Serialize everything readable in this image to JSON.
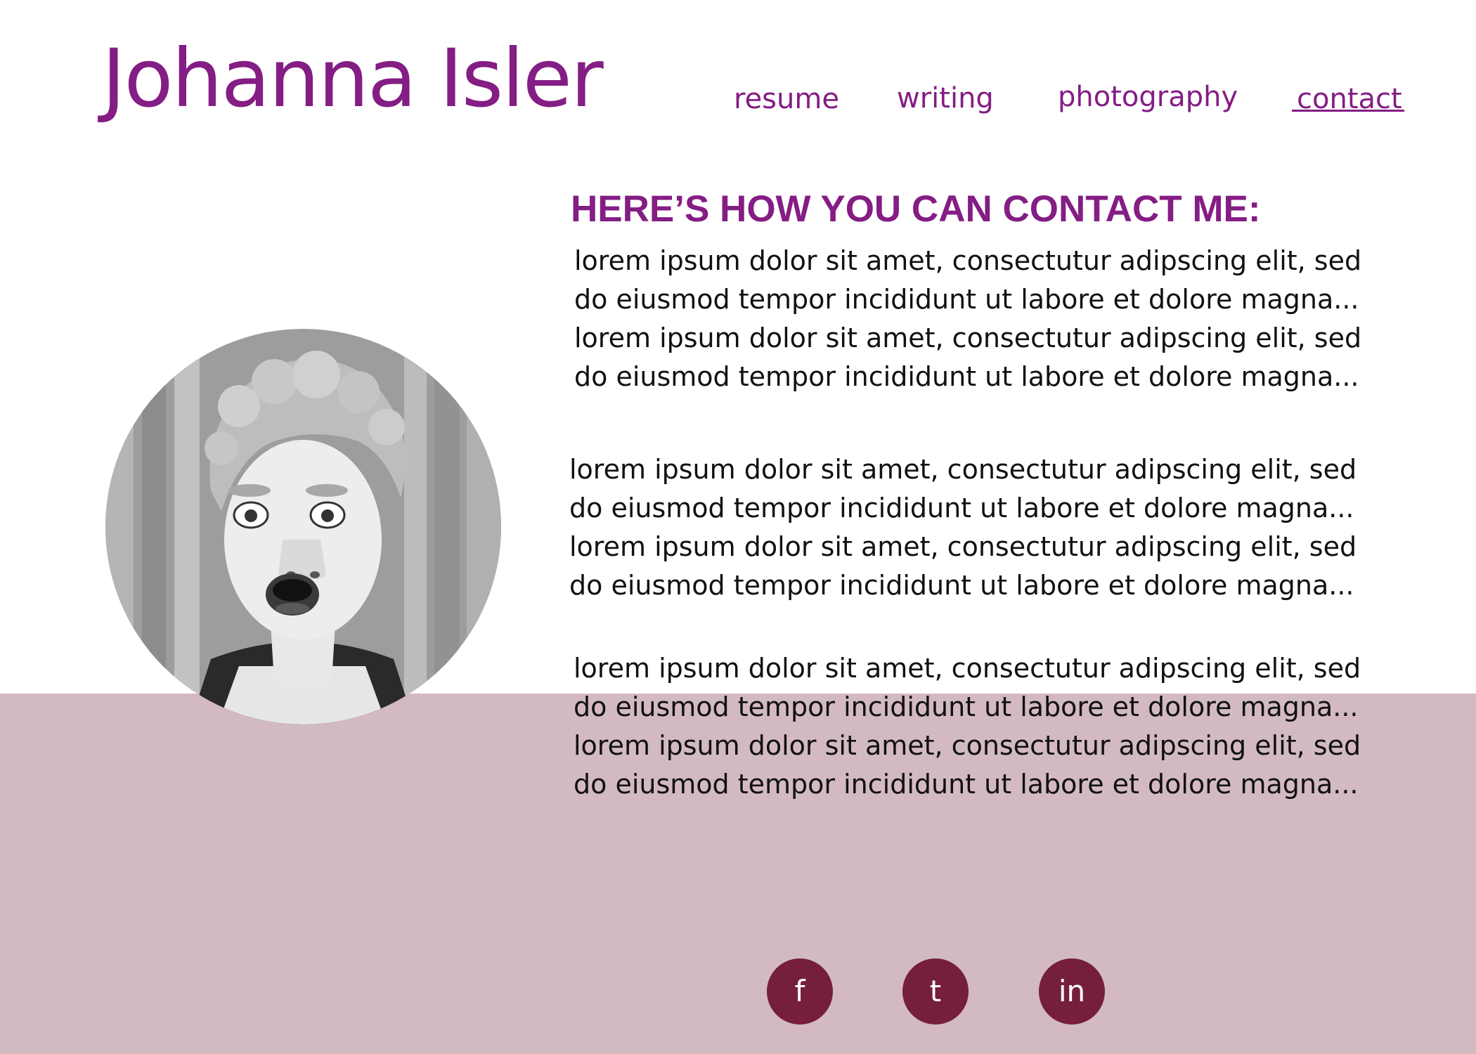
{
  "header": {
    "site_title": "Johanna Isler",
    "nav": [
      {
        "label": "resume"
      },
      {
        "label": "writing"
      },
      {
        "label": "photography"
      },
      {
        "label": "contact"
      }
    ],
    "active_nav": "contact"
  },
  "main": {
    "heading": "HERE’S HOW YOU CAN CONTACT ME:",
    "paragraphs": [
      {
        "lines": [
          "lorem ipsum dolor sit amet, consectutur adipscing elit, sed",
          "do eiusmod tempor incididunt ut labore et dolore magna...",
          "lorem ipsum dolor sit amet, consectutur adipscing elit, sed",
          "do eiusmod tempor incididunt ut labore et dolore magna..."
        ]
      },
      {
        "lines": [
          "lorem ipsum dolor sit amet, consectutur adipscing elit, sed",
          "do eiusmod tempor incididunt ut labore et dolore magna...",
          "lorem ipsum dolor sit amet, consectutur adipscing elit, sed",
          "do eiusmod tempor incididunt ut labore et dolore magna..."
        ]
      },
      {
        "lines": [
          "lorem ipsum dolor sit amet, consectutur adipscing elit, sed",
          "do eiusmod tempor incididunt ut labore et dolore magna...",
          "lorem ipsum dolor sit amet, consectutur adipscing elit, sed",
          "do eiusmod tempor incididunt ut labore et dolore magna..."
        ]
      }
    ],
    "photo_icon": "profile-photo-icon"
  },
  "footer": {
    "social": [
      {
        "label": "f",
        "icon": "facebook-icon"
      },
      {
        "label": "t",
        "icon": "twitter-icon"
      },
      {
        "label": "in",
        "icon": "linkedin-icon"
      }
    ]
  },
  "colors": {
    "accent": "#841d84",
    "footer_background": "#d3bac1",
    "social_circle": "#751f3a",
    "body_text": "#111111",
    "background": "#ffffff"
  }
}
